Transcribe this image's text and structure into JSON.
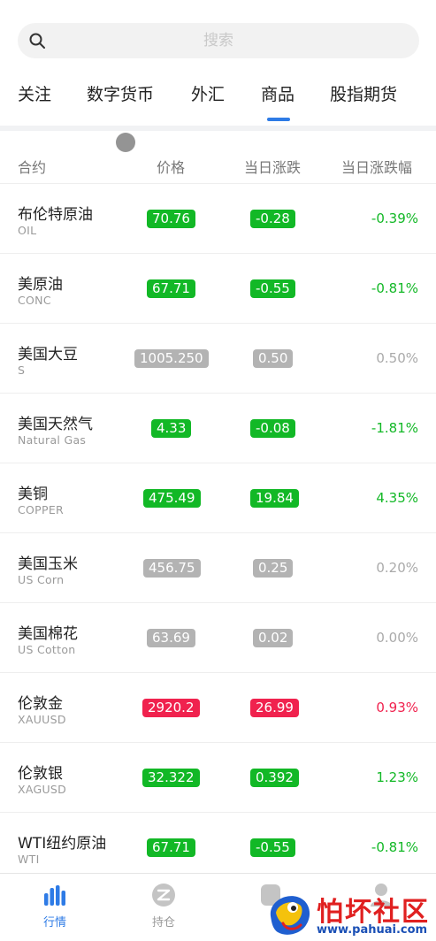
{
  "search": {
    "placeholder": "搜索"
  },
  "tabs": [
    {
      "label": "关注"
    },
    {
      "label": "数字货币"
    },
    {
      "label": "外汇"
    },
    {
      "label": "商品",
      "active": true
    },
    {
      "label": "股指期货"
    }
  ],
  "columns": {
    "contract": "合约",
    "price": "价格",
    "change": "当日涨跌",
    "change_pct": "当日涨跌幅"
  },
  "colors": {
    "up_green": "#12b826",
    "down_red": "#f0224e",
    "flat_gray": "#b3b3b3",
    "accent": "#2e7be6"
  },
  "rows": [
    {
      "name": "布伦特原油",
      "code": "OIL",
      "price": "70.76",
      "change": "-0.28",
      "pct": "-0.39%",
      "trend": "green"
    },
    {
      "name": "美原油",
      "code": "CONC",
      "price": "67.71",
      "change": "-0.55",
      "pct": "-0.81%",
      "trend": "green"
    },
    {
      "name": "美国大豆",
      "code": "S",
      "price": "1005.250",
      "change": "0.50",
      "pct": "0.50%",
      "trend": "gray"
    },
    {
      "name": "美国天然气",
      "code": "Natural Gas",
      "price": "4.33",
      "change": "-0.08",
      "pct": "-1.81%",
      "trend": "green"
    },
    {
      "name": "美铜",
      "code": "COPPER",
      "price": "475.49",
      "change": "19.84",
      "pct": "4.35%",
      "trend": "green"
    },
    {
      "name": "美国玉米",
      "code": "US Corn",
      "price": "456.75",
      "change": "0.25",
      "pct": "0.20%",
      "trend": "gray"
    },
    {
      "name": "美国棉花",
      "code": "US Cotton",
      "price": "63.69",
      "change": "0.02",
      "pct": "0.00%",
      "trend": "gray"
    },
    {
      "name": "伦敦金",
      "code": "XAUUSD",
      "price": "2920.2",
      "change": "26.99",
      "pct": "0.93%",
      "trend": "red"
    },
    {
      "name": "伦敦银",
      "code": "XAGUSD",
      "price": "32.322",
      "change": "0.392",
      "pct": "1.23%",
      "trend": "green"
    },
    {
      "name": "WTI纽约原油",
      "code": "WTI",
      "price": "67.71",
      "change": "-0.55",
      "pct": "-0.81%",
      "trend": "green"
    }
  ],
  "bottom_nav": [
    {
      "label": "行情",
      "icon": "bar-chart-icon",
      "active": true
    },
    {
      "label": "持仓",
      "icon": "position-icon"
    },
    {
      "label": "",
      "icon": "trade-icon"
    },
    {
      "label": "",
      "icon": "profile-icon"
    }
  ],
  "watermark": {
    "title": "怕坏社区",
    "url": "www.pahuai.com"
  }
}
